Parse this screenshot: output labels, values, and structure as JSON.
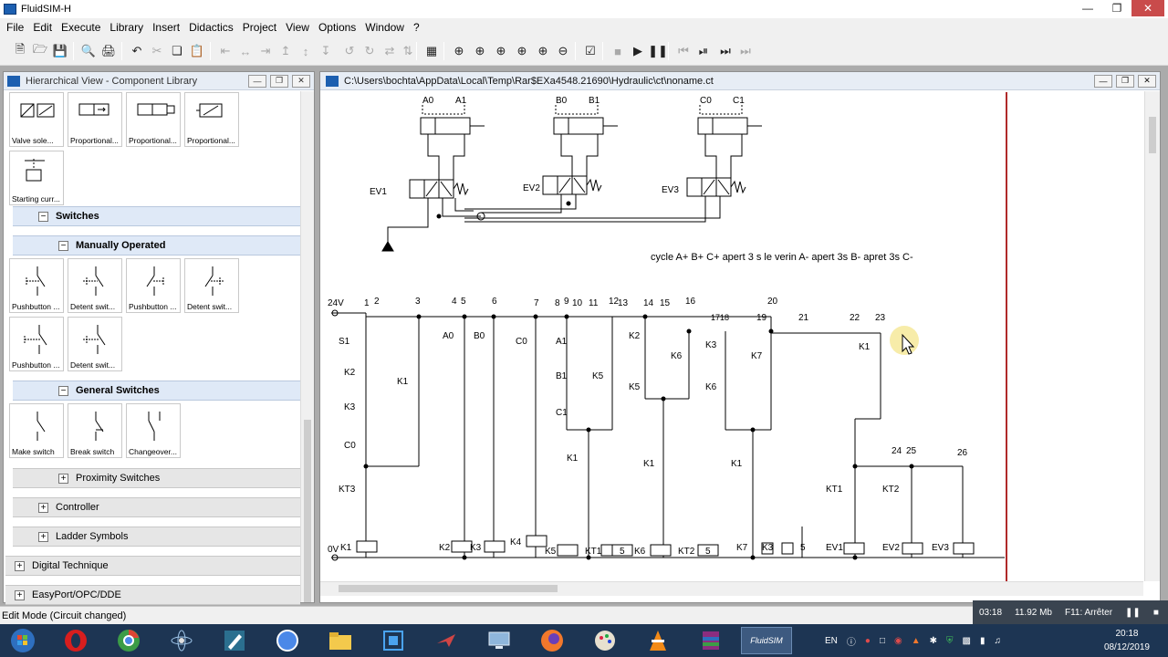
{
  "app": {
    "title": "FluidSIM-H"
  },
  "menu": [
    "File",
    "Edit",
    "Execute",
    "Library",
    "Insert",
    "Didactics",
    "Project",
    "View",
    "Options",
    "Window",
    "?"
  ],
  "library": {
    "title": "Hierarchical View - Component Library",
    "top_tiles": [
      "Valve sole...",
      "Proportional...",
      "Proportional...",
      "Proportional..."
    ],
    "starting_tile": "Starting curr...",
    "groups": {
      "switches": "Switches",
      "manually_operated": "Manually Operated",
      "general_switches": "General Switches",
      "proximity": "Proximity Switches",
      "controller": "Controller",
      "ladder": "Ladder Symbols",
      "digital": "Digital Technique",
      "easyport": "EasyPort/OPC/DDE"
    },
    "manual_tiles": [
      "Pushbutton ...",
      "Detent swit...",
      "Pushbutton ...",
      "Detent swit...",
      "Pushbutton ...",
      "Detent swit..."
    ],
    "general_tiles": [
      "Make switch",
      "Break switch",
      "Changeover..."
    ]
  },
  "circuit": {
    "path": "C:\\Users\\bochta\\AppData\\Local\\Temp\\Rar$EXa4548.21690\\Hydraulic\\ct\\noname.ct",
    "cycle_text": "cycle  A+ B+ C+  apert 3 s le verin A- apert 3s B- apret 3s C-",
    "cylinders": [
      {
        "sensors": [
          "A0",
          "A1"
        ],
        "valve": "EV1"
      },
      {
        "sensors": [
          "B0",
          "B1"
        ],
        "valve": "EV2"
      },
      {
        "sensors": [
          "C0",
          "C1"
        ],
        "valve": "EV3"
      }
    ],
    "rail_top": "24V",
    "rail_bottom": "0V",
    "node_numbers": [
      "1",
      "2",
      "3",
      "4",
      "5",
      "6",
      "7",
      "8",
      "9",
      "10",
      "11",
      "12",
      "13",
      "14",
      "15",
      "16",
      "17",
      "18",
      "19",
      "20",
      "21",
      "22",
      "23",
      "24",
      "25",
      "26"
    ],
    "contacts": {
      "s1": "S1",
      "k2a": "K2",
      "k3a": "K3",
      "c0a": "C0",
      "kt3": "KT3",
      "k1a": "K1",
      "a0": "A0",
      "b0": "B0",
      "c0b": "C0",
      "a1": "A1",
      "b1": "B1",
      "c1": "C1",
      "k5": "K5",
      "k1b": "K1",
      "k2b": "K2",
      "k5b": "K5",
      "k6": "K6",
      "k1c": "K1",
      "k3b": "K3",
      "k6b": "K6",
      "k7": "K7",
      "k1d": "K1",
      "k1e": "K1",
      "kt1": "KT1",
      "kt2": "KT2"
    },
    "coils": {
      "k1": "K1",
      "k2": "K2",
      "k3": "K3",
      "k4": "K4",
      "k5": "K5",
      "kt1": "KT1",
      "t1": "5",
      "k6": "K6",
      "kt2": "KT2",
      "t2": "5",
      "k7": "K7",
      "k3b": "K3",
      "t3": "5",
      "ev1": "EV1",
      "ev2": "EV2",
      "ev3": "EV3"
    }
  },
  "status": {
    "mode": "Edit Mode (Circuit changed)",
    "time": "03:18",
    "memory": "11.92 Mb",
    "stop_hint": "F11: Arrêter"
  },
  "tray": {
    "lang": "EN",
    "clock": "20:18",
    "date": "08/12/2019"
  },
  "taskbar_active": "FluidSIM"
}
